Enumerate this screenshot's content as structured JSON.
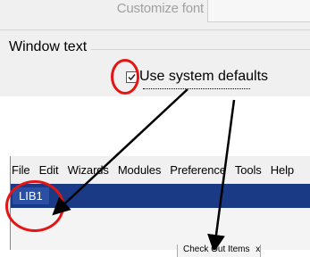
{
  "dialog": {
    "customize_font_label": "Customize font",
    "window_text_label": "Window text",
    "use_system_defaults_label": "Use system defaults",
    "use_system_defaults_checked": true
  },
  "app": {
    "menu": [
      "File",
      "Edit",
      "Wizards",
      "Modules",
      "Preference",
      "Tools",
      "Help"
    ],
    "tab_label": "LIB1",
    "checkout_tab_label": "Check Out Items",
    "tab_close": "x"
  },
  "colors": {
    "annotation_red": "#e31515",
    "tabbar_blue": "#1a3a86",
    "arrow": "#000000"
  }
}
